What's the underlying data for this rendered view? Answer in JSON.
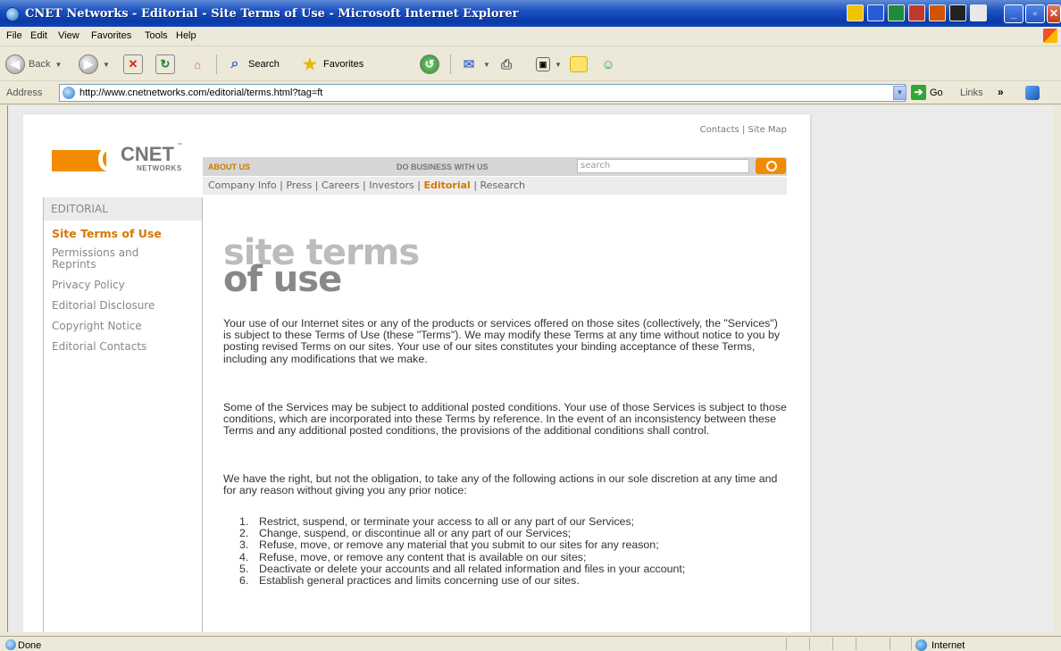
{
  "window": {
    "title": "CNET Networks - Editorial - Site Terms of Use - Microsoft Internet Explorer"
  },
  "menu": [
    "File",
    "Edit",
    "View",
    "Favorites",
    "Tools",
    "Help"
  ],
  "toolbar": {
    "back_label": "Back",
    "search_label": "Search",
    "favorites_label": "Favorites"
  },
  "address": {
    "label": "Address",
    "url": "http://www.cnetnetworks.com/editorial/terms.html?tag=ft",
    "go_label": "Go",
    "links_label": "Links"
  },
  "page": {
    "top_links": {
      "contacts": "Contacts",
      "separator": "|",
      "sitemap": "Site Map"
    },
    "logo": {
      "name": "CNET",
      "tm": "™",
      "sub": "NETWORKS"
    },
    "nav": {
      "about": "ABOUT US",
      "business": "DO BUSINESS WITH US",
      "search_placeholder": "search"
    },
    "subnav": [
      {
        "label": "Company Info",
        "current": false
      },
      {
        "label": "Press",
        "current": false
      },
      {
        "label": "Careers",
        "current": false
      },
      {
        "label": "Investors",
        "current": false
      },
      {
        "label": "Editorial",
        "current": true
      },
      {
        "label": "Research",
        "current": false
      }
    ],
    "sidebar": {
      "heading": "EDITORIAL",
      "items": [
        {
          "label": "Site Terms of Use",
          "active": true
        },
        {
          "label": "Permissions and Reprints",
          "active": false
        },
        {
          "label": "Privacy Policy",
          "active": false
        },
        {
          "label": "Editorial Disclosure",
          "active": false
        },
        {
          "label": "Copyright Notice",
          "active": false
        },
        {
          "label": "Editorial Contacts",
          "active": false
        }
      ]
    },
    "content": {
      "heading_line1": "site terms",
      "heading_line2": "of use",
      "paragraphs": [
        "Your use of our Internet sites or any of the products or services offered on those sites (collectively, the \"Services\") is subject to these Terms of Use (these \"Terms\"). We may modify these Terms at any time without notice to you by posting revised Terms on our sites. Your use of our sites constitutes your binding acceptance of these Terms, including any modifications that we make.",
        "Some of the Services may be subject to additional posted conditions. Your use of those Services is subject to those conditions, which are incorporated into these Terms by reference. In the event of an inconsistency between these Terms and any additional posted conditions, the provisions of the additional conditions shall control.",
        "We have the right, but not the obligation, to take any of the following actions in our sole discretion at any time and for any reason without giving you any prior notice:"
      ],
      "list": [
        {
          "num": "1.",
          "text": "Restrict, suspend, or terminate your access to all or any part of our Services;"
        },
        {
          "num": "2.",
          "text": "Change, suspend, or discontinue all or any part of our Services;"
        },
        {
          "num": "3.",
          "text": "Refuse, move, or remove any material that you submit to our sites for any reason;"
        },
        {
          "num": "4.",
          "text": "Refuse, move, or remove any content that is available on our sites;"
        },
        {
          "num": "5.",
          "text": "Deactivate or delete your accounts and all related information and files in your account;"
        },
        {
          "num": "6.",
          "text": "Establish general practices and limits concerning use of our sites."
        }
      ]
    }
  },
  "status": {
    "text": "Done",
    "zone": "Internet"
  }
}
